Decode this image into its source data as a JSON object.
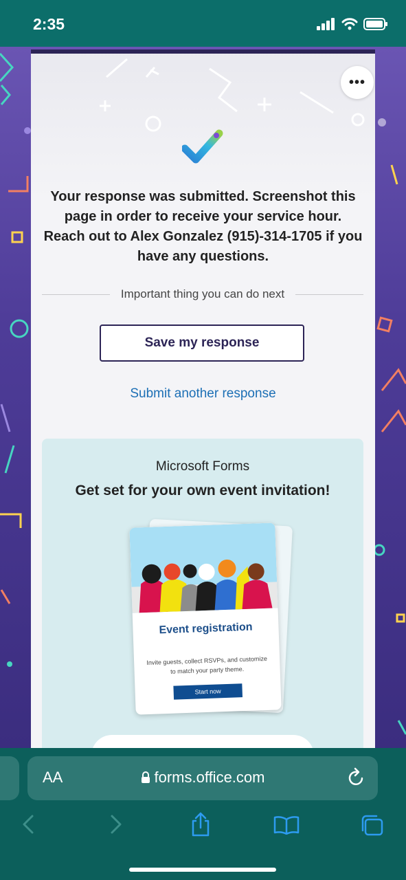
{
  "status": {
    "time": "2:35"
  },
  "form": {
    "message_lines": [
      "Your response was submitted. Screenshot this",
      "page in order to receive your service hour.",
      "Reach out to Alex Gonzalez (915)-314-1705 if you",
      "have any questions."
    ],
    "divider_text": "Important thing you can do next",
    "save_label": "Save my response",
    "another_label": "Submit another response",
    "more_label": "•••"
  },
  "promo": {
    "brand": "Microsoft Forms",
    "headline": "Get set for your own event invitation!",
    "tile_title": "Event registration",
    "tile_desc_line1": "Invite guests, collect RSVPs, and customize",
    "tile_desc_line2": "to match your party theme.",
    "tile_button": "Start now"
  },
  "browser": {
    "text_size_label": "AA",
    "url": "forms.office.com"
  },
  "colors": {
    "status_bg": "#0c6e6a",
    "accent": "#2c2456",
    "link": "#1c6fb5",
    "promo_bg": "#d7ecef"
  },
  "icons": [
    "signal-icon",
    "wifi-icon",
    "battery-icon",
    "more-icon",
    "checkmark-icon",
    "lock-icon",
    "reload-icon",
    "back-icon",
    "forward-icon",
    "share-icon",
    "bookmarks-icon",
    "tabs-icon"
  ]
}
